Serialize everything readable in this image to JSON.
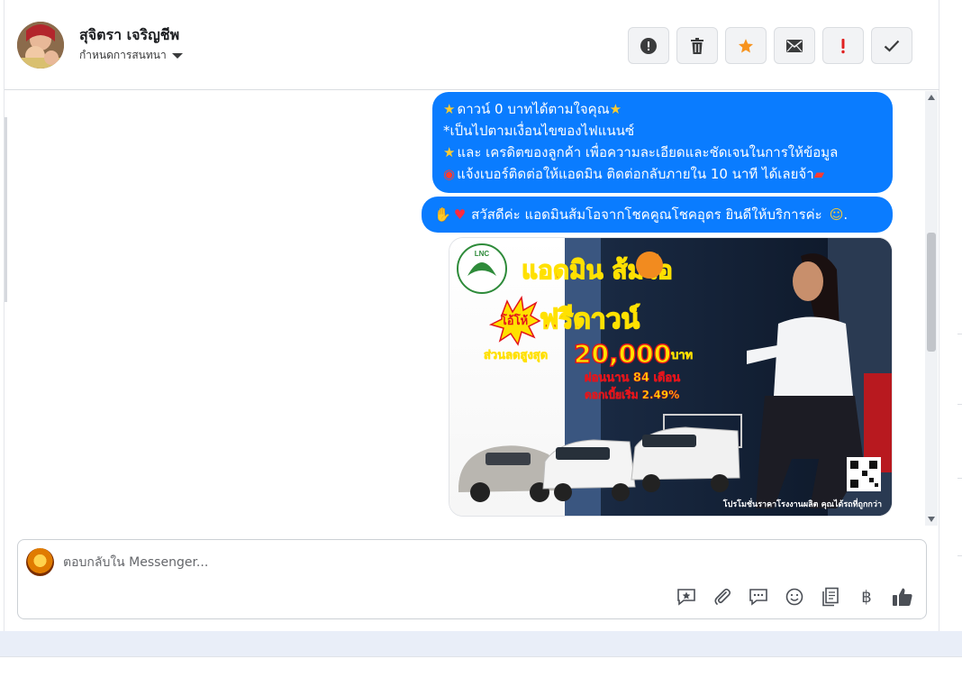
{
  "contact": {
    "name": "สุจิตรา เจริญชีพ",
    "assign_label": "กำหนดการสนทนา"
  },
  "header_actions": [
    {
      "name": "report-button",
      "icon": "alert-circle-icon"
    },
    {
      "name": "delete-button",
      "icon": "trash-icon"
    },
    {
      "name": "star-button",
      "icon": "star-icon"
    },
    {
      "name": "mark-unread-button",
      "icon": "envelope-icon"
    },
    {
      "name": "important-button",
      "icon": "exclamation-icon"
    },
    {
      "name": "done-button",
      "icon": "check-icon"
    }
  ],
  "messages": {
    "m1": {
      "l1": "ดาวน์ 0 บาทได้ตามใจคุณ",
      "l2": "*เป็นไปตามเงื่อนไขของไฟแนนซ์",
      "l3": "และ เครดิตของลูกค้า เพื่อความละเอียดและชัดเจนในการให้ข้อมูล",
      "l4": "แจ้งเบอร์ติดต่อให้แอดมิน ติดต่อกลับภายใน 10 นาที ได้เลยจ้า"
    },
    "m2": "สวัสดีค่ะ แอดมินส้มโอจากโชคคูณโชคอุดร ยินดีให้บริการค่ะ",
    "m2_tail": ".",
    "promo": {
      "logo_text": "LNC",
      "title": "แอดมิน ส้มโอ",
      "badge": "โอ้โห้",
      "headline": "ฟรีดาวน์",
      "discount_label": "ส่วนลดสูงสุด",
      "discount_value": "20,000",
      "discount_unit": "บาท",
      "term": "ผ่อนนาน 84 เดือน",
      "rate": "ดอกเบี้ยเริ่ม 2.49%",
      "footer": "โปรโมชั่นราคาโรงงานผลิต คุณได้รถที่ถูกกว่า"
    }
  },
  "composer": {
    "placeholder": "ตอบกลับใน Messenger..."
  },
  "composer_tools": [
    {
      "name": "saved-reply-button",
      "icon": "saved-reply-icon"
    },
    {
      "name": "attach-button",
      "icon": "paperclip-icon"
    },
    {
      "name": "quick-reply-button",
      "icon": "chat-bubble-icon"
    },
    {
      "name": "emoji-button",
      "icon": "smiley-icon"
    },
    {
      "name": "note-button",
      "icon": "note-icon"
    },
    {
      "name": "payment-button",
      "icon": "baht-icon",
      "label": "฿"
    },
    {
      "name": "like-button",
      "icon": "thumbs-up-icon"
    }
  ],
  "colors": {
    "bubble": "#0a7cff",
    "star_active": "#f7931e",
    "important": "#e02020",
    "promo_red": "#e3141c",
    "promo_yellow": "#ffe100"
  }
}
